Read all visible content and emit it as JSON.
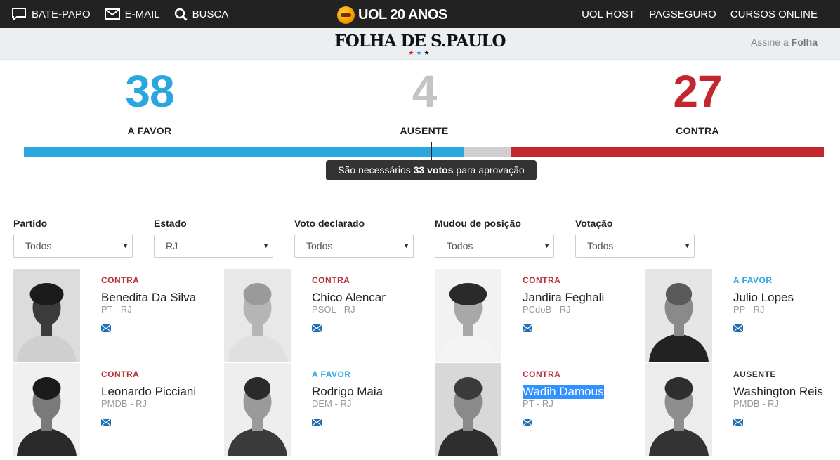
{
  "topbar": {
    "links": [
      "BATE-PAPO",
      "E-MAIL",
      "BUSCA"
    ],
    "logo": "UOL 20 ANOS",
    "right_links": [
      "UOL HOST",
      "PAGSEGURO",
      "CURSOS ONLINE"
    ]
  },
  "header": {
    "masthead": "FOLHA DE S.PAULO",
    "subscribe_prefix": "Assine a",
    "subscribe_brand": "Folha"
  },
  "tally": {
    "favor": {
      "count": "38",
      "label": "A FAVOR"
    },
    "ausente": {
      "count": "4",
      "label": "AUSENTE"
    },
    "contra": {
      "count": "27",
      "label": "CONTRA"
    },
    "bar_values": {
      "favor": 38,
      "ausente": 4,
      "contra": 27
    },
    "colors": {
      "favor": "#2ba7df",
      "ausente": "#cfcfcf",
      "contra": "#c1272d"
    },
    "threshold_prefix": "São necessários",
    "threshold_bold": "33 votos",
    "threshold_suffix": "para aprovação"
  },
  "filters": [
    {
      "label": "Partido",
      "value": "Todos"
    },
    {
      "label": "Estado",
      "value": "RJ"
    },
    {
      "label": "Voto declarado",
      "value": "Todos"
    },
    {
      "label": "Mudou de posição",
      "value": "Todos"
    },
    {
      "label": "Votação",
      "value": "Todos"
    }
  ],
  "senators": [
    {
      "vote": "CONTRA",
      "name": "Benedita Da Silva",
      "party": "PT - RJ"
    },
    {
      "vote": "CONTRA",
      "name": "Chico Alencar",
      "party": "PSOL - RJ"
    },
    {
      "vote": "CONTRA",
      "name": "Jandira Feghali",
      "party": "PCdoB - RJ"
    },
    {
      "vote": "A FAVOR",
      "name": "Julio Lopes",
      "party": "PP - RJ"
    },
    {
      "vote": "CONTRA",
      "name": "Leonardo Picciani",
      "party": "PMDB - RJ"
    },
    {
      "vote": "A FAVOR",
      "name": "Rodrigo Maia",
      "party": "DEM - RJ"
    },
    {
      "vote": "CONTRA",
      "name": "Wadih Damous",
      "party": "PT - RJ"
    },
    {
      "vote": "AUSENTE",
      "name": "Washington Reis",
      "party": "PMDB - RJ"
    }
  ],
  "vote_colors": {
    "CONTRA": "#b5323a",
    "A FAVOR": "#2ba7df",
    "AUSENTE": "#333333"
  },
  "mail_icon_color": "#1f6fb4"
}
